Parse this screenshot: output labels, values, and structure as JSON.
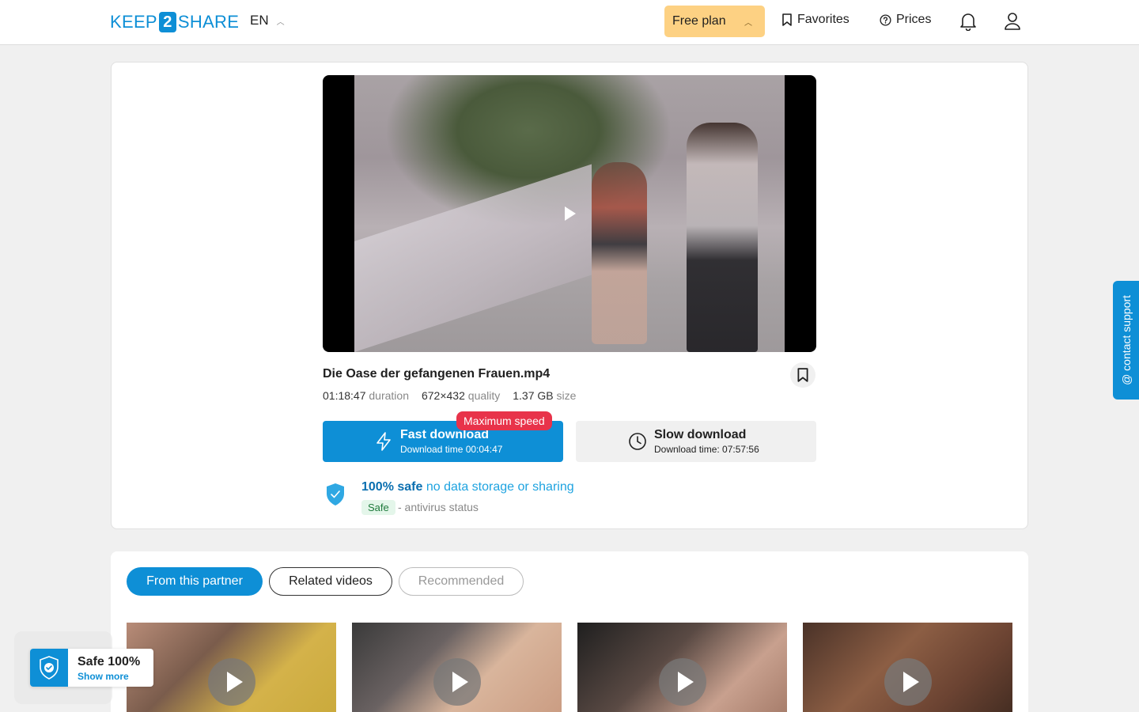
{
  "header": {
    "logo_left": "KEEP",
    "logo_mid": "2",
    "logo_right": "SHARE",
    "language": "EN",
    "plan_label": "Free plan",
    "favorites_label": "Favorites",
    "prices_label": "Prices"
  },
  "file": {
    "name": "Die Oase der gefangenen Frauen.mp4",
    "duration": "01:18:47",
    "duration_label": "duration",
    "quality": "672×432",
    "quality_label": "quality",
    "size": "1.37 GB",
    "size_label": "size"
  },
  "download": {
    "badge": "Maximum speed",
    "fast_title": "Fast download",
    "fast_sub": "Download time 00:04:47",
    "slow_title": "Slow download",
    "slow_sub": "Download time: 07:57:56"
  },
  "safety": {
    "strong": "100% safe",
    "soft": "no data storage or sharing",
    "badge": "Safe",
    "status": "- antivirus status"
  },
  "tabs": [
    {
      "label": "From this partner",
      "active": true
    },
    {
      "label": "Related videos",
      "active": false
    },
    {
      "label": "Recommended",
      "active": false
    }
  ],
  "support_label": "@ contact support",
  "safe_widget": {
    "title": "Safe 100%",
    "link": "Show more"
  },
  "colors": {
    "accent": "#0e8fd6",
    "plan": "#fdd183",
    "badge_red": "#e8334a"
  }
}
